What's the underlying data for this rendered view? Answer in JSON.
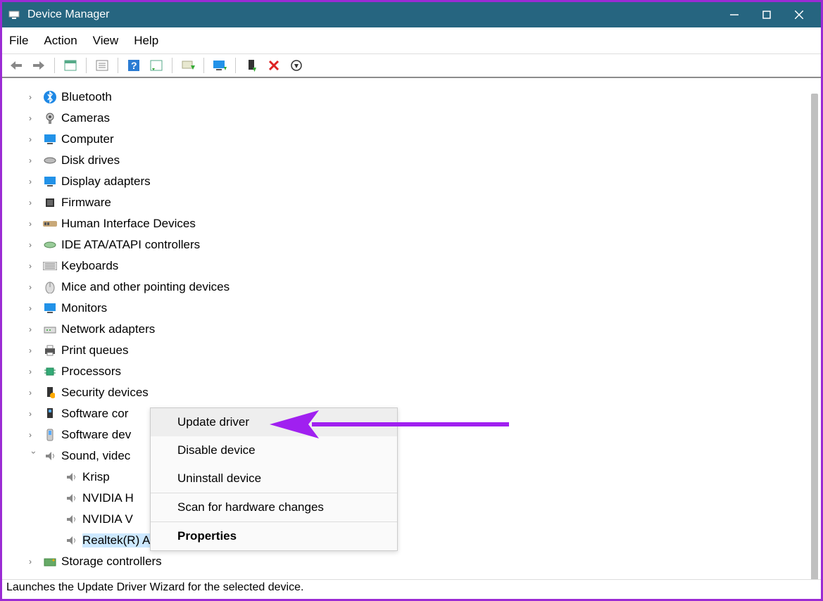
{
  "window": {
    "title": "Device Manager"
  },
  "menu": {
    "file": "File",
    "action": "Action",
    "view": "View",
    "help": "Help"
  },
  "tree": {
    "items": [
      {
        "label": "Bluetooth",
        "icon": "bluetooth-icon"
      },
      {
        "label": "Cameras",
        "icon": "camera-icon"
      },
      {
        "label": "Computer",
        "icon": "computer-icon"
      },
      {
        "label": "Disk drives",
        "icon": "disk-icon"
      },
      {
        "label": "Display adapters",
        "icon": "display-icon"
      },
      {
        "label": "Firmware",
        "icon": "firmware-icon"
      },
      {
        "label": "Human Interface Devices",
        "icon": "hid-icon"
      },
      {
        "label": "IDE ATA/ATAPI controllers",
        "icon": "ide-icon"
      },
      {
        "label": "Keyboards",
        "icon": "keyboard-icon"
      },
      {
        "label": "Mice and other pointing devices",
        "icon": "mouse-icon"
      },
      {
        "label": "Monitors",
        "icon": "monitor-icon"
      },
      {
        "label": "Network adapters",
        "icon": "network-icon"
      },
      {
        "label": "Print queues",
        "icon": "printer-icon"
      },
      {
        "label": "Processors",
        "icon": "cpu-icon"
      },
      {
        "label": "Security devices",
        "icon": "security-icon"
      },
      {
        "label": "Software cor",
        "icon": "software-icon"
      },
      {
        "label": "Software dev",
        "icon": "software-dev-icon"
      }
    ],
    "expanded": {
      "label": "Sound, videc",
      "icon": "sound-icon",
      "children": [
        {
          "label": "Krisp"
        },
        {
          "label": "NVIDIA H"
        },
        {
          "label": "NVIDIA V"
        },
        {
          "label": "Realtek(R) Audio",
          "selected": true
        }
      ]
    },
    "after": [
      {
        "label": "Storage controllers",
        "icon": "storage-icon"
      }
    ]
  },
  "context_menu": {
    "update": "Update driver",
    "disable": "Disable device",
    "uninstall": "Uninstall device",
    "scan": "Scan for hardware changes",
    "properties": "Properties"
  },
  "status_bar": {
    "text": "Launches the Update Driver Wizard for the selected device."
  }
}
